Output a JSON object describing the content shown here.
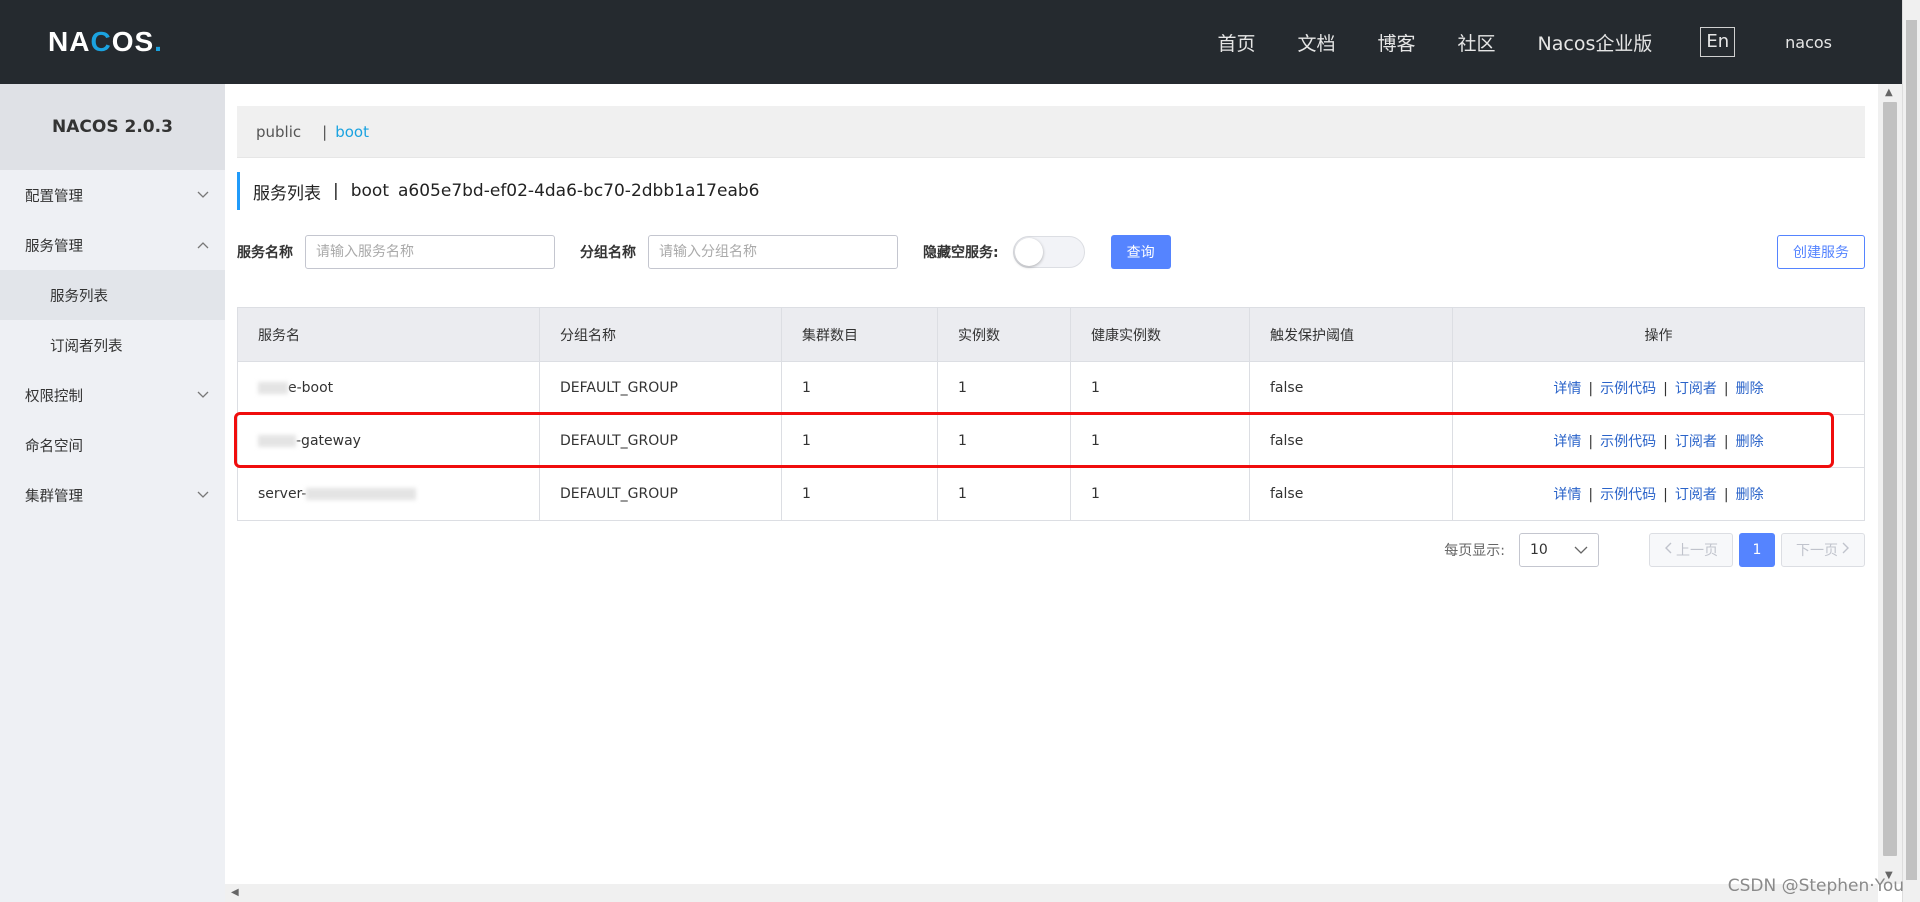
{
  "topbar": {
    "logo_pre": "NA",
    "logo_o": "C",
    "logo_post": "OS",
    "logo_dot": ".",
    "nav": [
      "首页",
      "文档",
      "博客",
      "社区",
      "Nacos企业版"
    ],
    "lang": "En",
    "user": "nacos"
  },
  "sidebar": {
    "version": "NACOS 2.0.3",
    "items": {
      "config": "配置管理",
      "service": "服务管理",
      "service_list": "服务列表",
      "subscriber_list": "订阅者列表",
      "auth": "权限控制",
      "namespace": "命名空间",
      "cluster": "集群管理"
    }
  },
  "namespace_bar": {
    "items": [
      "public",
      "boot"
    ],
    "separator": "|"
  },
  "page_title": {
    "label": "服务列表",
    "sep": "|",
    "namespace": "boot",
    "namespace_id": "a605e7bd-ef02-4da6-bc70-2dbb1a17eab6"
  },
  "filters": {
    "service_name_label": "服务名称",
    "service_name_placeholder": "请输入服务名称",
    "group_name_label": "分组名称",
    "group_name_placeholder": "请输入分组名称",
    "hide_empty_label": "隐藏空服务:",
    "hide_empty_on": false,
    "query_button": "查询",
    "create_button": "创建服务"
  },
  "table": {
    "headers": [
      "服务名",
      "分组名称",
      "集群数目",
      "实例数",
      "健康实例数",
      "触发保护阈值",
      "操作"
    ],
    "rows": [
      {
        "name": "e-boot",
        "group": "DEFAULT_GROUP",
        "clusters": "1",
        "instances": "1",
        "healthy": "1",
        "protect": "false"
      },
      {
        "name": "-gateway",
        "group": "DEFAULT_GROUP",
        "clusters": "1",
        "instances": "1",
        "healthy": "1",
        "protect": "false"
      },
      {
        "name": "server-",
        "group": "DEFAULT_GROUP",
        "clusters": "1",
        "instances": "1",
        "healthy": "1",
        "protect": "false"
      }
    ],
    "ops": {
      "detail": "详情",
      "sample_code": "示例代码",
      "subscribers": "订阅者",
      "delete": "删除",
      "sep": "|"
    }
  },
  "pager": {
    "page_size_label": "每页显示:",
    "page_size": "10",
    "prev": "上一页",
    "current": "1",
    "next": "下一页"
  },
  "watermark": "CSDN @Stephen·You",
  "colors": {
    "accent": "#5584ff",
    "link": "#2a63c9",
    "highlight": "#f00d0d",
    "topbar": "#252a2f"
  }
}
